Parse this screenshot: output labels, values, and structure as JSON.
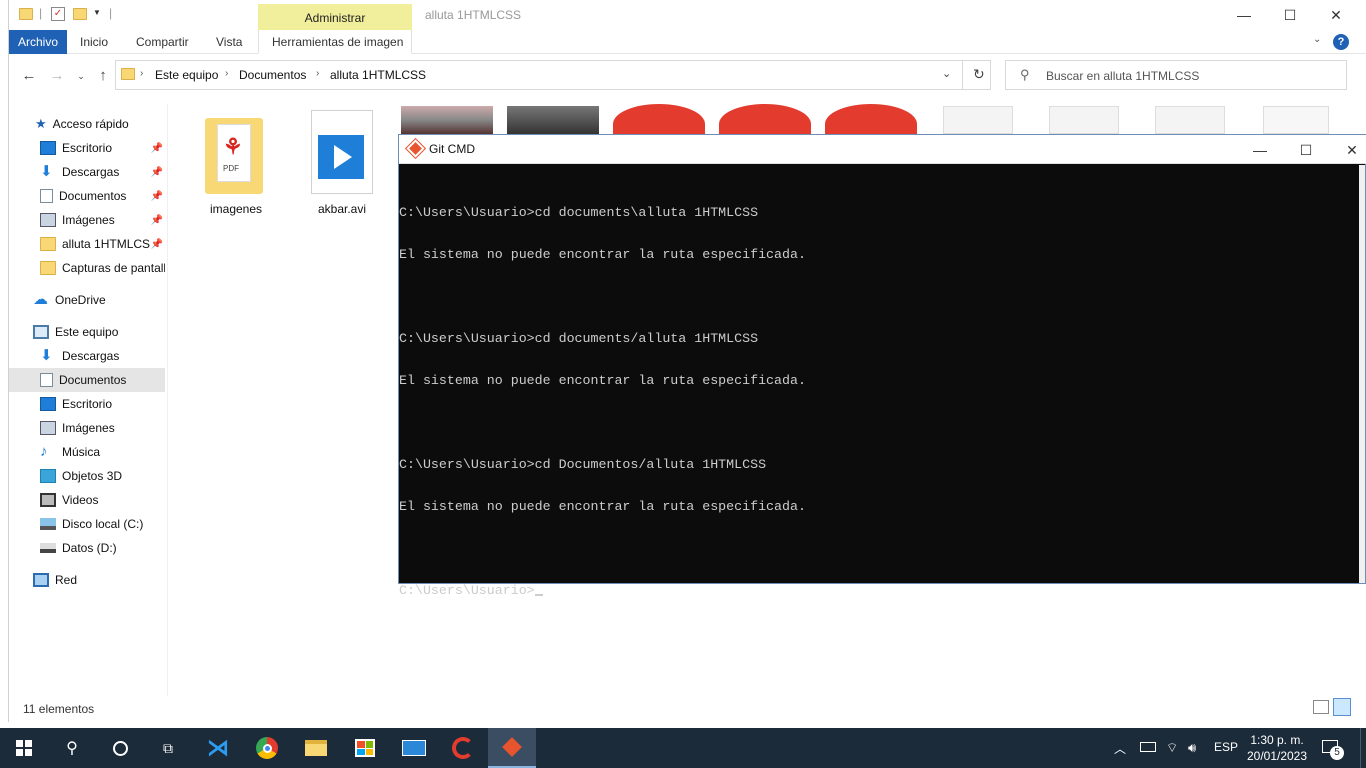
{
  "explorer": {
    "window_title": "alluta 1HTMLCSS",
    "context_tab": "Administrar",
    "ribbon_tabs": [
      "Archivo",
      "Inicio",
      "Compartir",
      "Vista",
      "Herramientas de imagen"
    ],
    "breadcrumb": [
      "Este equipo",
      "Documentos",
      "alluta 1HTMLCSS"
    ],
    "search_placeholder": "Buscar en alluta 1HTMLCSS",
    "nav": {
      "quick_access": "Acceso rápido",
      "quick_items": [
        "Escritorio",
        "Descargas",
        "Documentos",
        "Imágenes",
        "alluta 1HTMLCSS",
        "Capturas de pantall"
      ],
      "onedrive": "OneDrive",
      "this_pc": "Este equipo",
      "pc_items": [
        "Descargas",
        "Documentos",
        "Escritorio",
        "Imágenes",
        "Música",
        "Objetos 3D",
        "Videos",
        "Disco local (C:)",
        "Datos (D:)"
      ],
      "network": "Red"
    },
    "files": [
      "imagenes",
      "akbar.avi"
    ],
    "status": "11 elementos"
  },
  "cmd": {
    "title": "Git CMD",
    "lines": [
      "C:\\Users\\Usuario>cd documents\\alluta 1HTMLCSS",
      "El sistema no puede encontrar la ruta especificada.",
      "",
      "C:\\Users\\Usuario>cd documents/alluta 1HTMLCSS",
      "El sistema no puede encontrar la ruta especificada.",
      "",
      "C:\\Users\\Usuario>cd Documentos/alluta 1HTMLCSS",
      "El sistema no puede encontrar la ruta especificada.",
      ""
    ],
    "prompt": "C:\\Users\\Usuario>"
  },
  "taskbar": {
    "language": "ESP",
    "time": "1:30 p. m.",
    "date": "20/01/2023",
    "notifications": "5"
  },
  "colors": {
    "accent": "#1f61b4",
    "context_tab": "#f1ee9c",
    "taskbar": "#1c2b3a",
    "console_bg": "#0c0c0c",
    "console_fg": "#cccccc"
  }
}
